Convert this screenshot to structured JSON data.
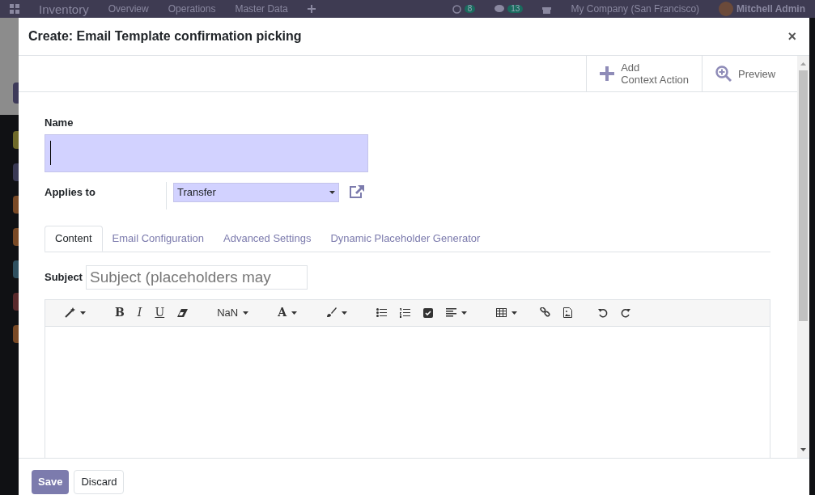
{
  "navbar": {
    "app": "Inventory",
    "menu": [
      "Overview",
      "Operations",
      "Master Data"
    ],
    "activity_count": "8",
    "message_count": "13",
    "company": "My Company (San Francisco)",
    "user": "Mitchell Admin"
  },
  "dialog": {
    "title": "Create: Email Template confirmation picking",
    "close": "×"
  },
  "button_box": [
    {
      "kind": "add",
      "label": "Add",
      "sublabel": "Context Action"
    },
    {
      "kind": "preview",
      "label": "Preview"
    }
  ],
  "form": {
    "name_label": "Name",
    "applies_label": "Applies to",
    "applies_value": "Transfer"
  },
  "tabs": [
    {
      "label": "Content",
      "selected": true
    },
    {
      "label": "Email Configuration",
      "selected": false
    },
    {
      "label": "Advanced Settings",
      "selected": false
    },
    {
      "label": "Dynamic Placeholder Generator",
      "selected": false
    }
  ],
  "subject": {
    "label": "Subject",
    "placeholder": "Subject (placeholders may"
  },
  "toolbar": [
    {
      "kind": "magic",
      "caret": true
    },
    {
      "kind": "bold",
      "glyph": "B"
    },
    {
      "kind": "italic",
      "glyph": "I"
    },
    {
      "kind": "underline",
      "glyph": "U"
    },
    {
      "kind": "eraser"
    },
    {
      "kind": "text",
      "text": "NaN",
      "caret": true
    },
    {
      "kind": "font-color",
      "glyph": "A",
      "caret": true
    },
    {
      "kind": "brush",
      "caret": true
    },
    {
      "kind": "bullets"
    },
    {
      "kind": "numbers"
    },
    {
      "kind": "checklist"
    },
    {
      "kind": "align",
      "caret": true
    },
    {
      "kind": "table",
      "caret": true
    },
    {
      "kind": "link"
    },
    {
      "kind": "image"
    },
    {
      "kind": "undo"
    },
    {
      "kind": "redo"
    }
  ],
  "footer": {
    "save": "Save",
    "discard": "Discard"
  }
}
